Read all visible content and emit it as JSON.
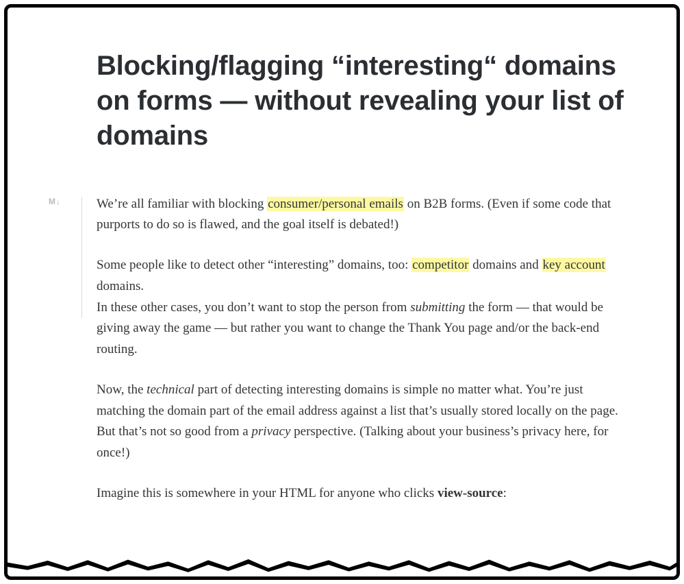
{
  "title": "Blocking/flagging “interesting“ domains on forms — without revealing your list of domains",
  "gutter_badge": "M↓",
  "paragraphs": {
    "p1": {
      "t1": "We’re all familiar with blocking ",
      "h1": "consumer/personal emails",
      "t2": " on B2B forms. (Even if some code that purports to do so is flawed, and the goal itself is debated!)"
    },
    "p2": {
      "t1": "Some people like to detect other “interesting” domains, too: ",
      "h1": "competitor",
      "t2": " domains and ",
      "h2": "key account",
      "t3": " domains."
    },
    "p3": {
      "t1": "In these other cases, you don’t want to stop the person from ",
      "i1": "submitting",
      "t2": " the form — that would be giving away the game — but rather you want to change the Thank You page and/or the back-end routing."
    },
    "p4": {
      "t1": "Now, the ",
      "i1": "technical",
      "t2": " part of detecting interesting domains is simple no matter what. You’re just matching the domain part of the email address against a list that’s usually stored locally on the page. But that’s not so good from a ",
      "i2": "privacy",
      "t3": " perspective. (Talking about your business’s privacy here, for once!)"
    },
    "p5": {
      "t1": "Imagine this is somewhere in your HTML for anyone who clicks ",
      "b1": "view-source",
      "t2": ":"
    }
  }
}
